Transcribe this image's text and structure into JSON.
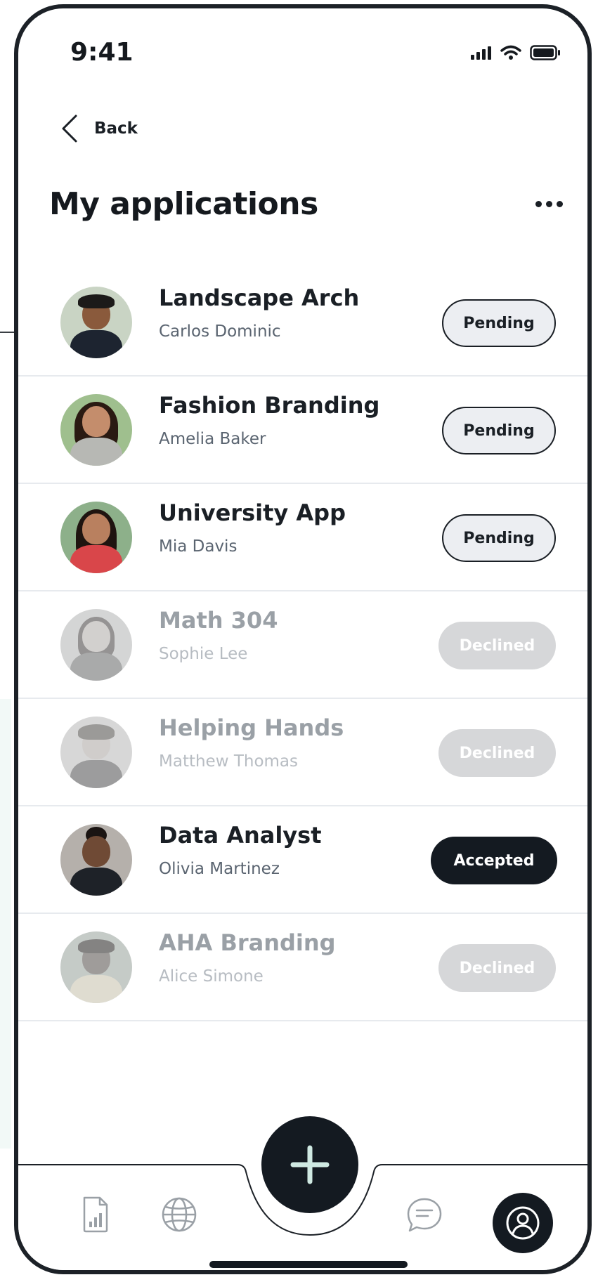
{
  "status_bar": {
    "time": "9:41"
  },
  "nav": {
    "back_label": "Back"
  },
  "page": {
    "title": "My applications"
  },
  "applications": [
    {
      "title": "Landscape Arch",
      "name": "Carlos Dominic",
      "status": "Pending",
      "state": "pending"
    },
    {
      "title": "Fashion Branding",
      "name": "Amelia Baker",
      "status": "Pending",
      "state": "pending"
    },
    {
      "title": "University App",
      "name": "Mia Davis",
      "status": "Pending",
      "state": "pending"
    },
    {
      "title": "Math 304",
      "name": "Sophie Lee",
      "status": "Declined",
      "state": "declined"
    },
    {
      "title": "Helping Hands",
      "name": "Matthew Thomas",
      "status": "Declined",
      "state": "declined"
    },
    {
      "title": "Data Analyst",
      "name": "Olivia Martinez",
      "status": "Accepted",
      "state": "accepted"
    },
    {
      "title": "AHA Branding",
      "name": "Alice Simone",
      "status": "Declined",
      "state": "declined"
    }
  ],
  "tab_bar": {
    "items": [
      {
        "icon": "report-icon",
        "active": false
      },
      {
        "icon": "globe-icon",
        "active": false
      },
      {
        "icon": "add-icon",
        "active": false
      },
      {
        "icon": "chat-icon",
        "active": false
      },
      {
        "icon": "profile-icon",
        "active": true
      }
    ]
  },
  "colors": {
    "primary": "#141a21",
    "accent": "#cfe9e2",
    "pending_bg": "#eceef2",
    "declined_bg": "#d6d7d9",
    "divider": "#e7eaee"
  }
}
